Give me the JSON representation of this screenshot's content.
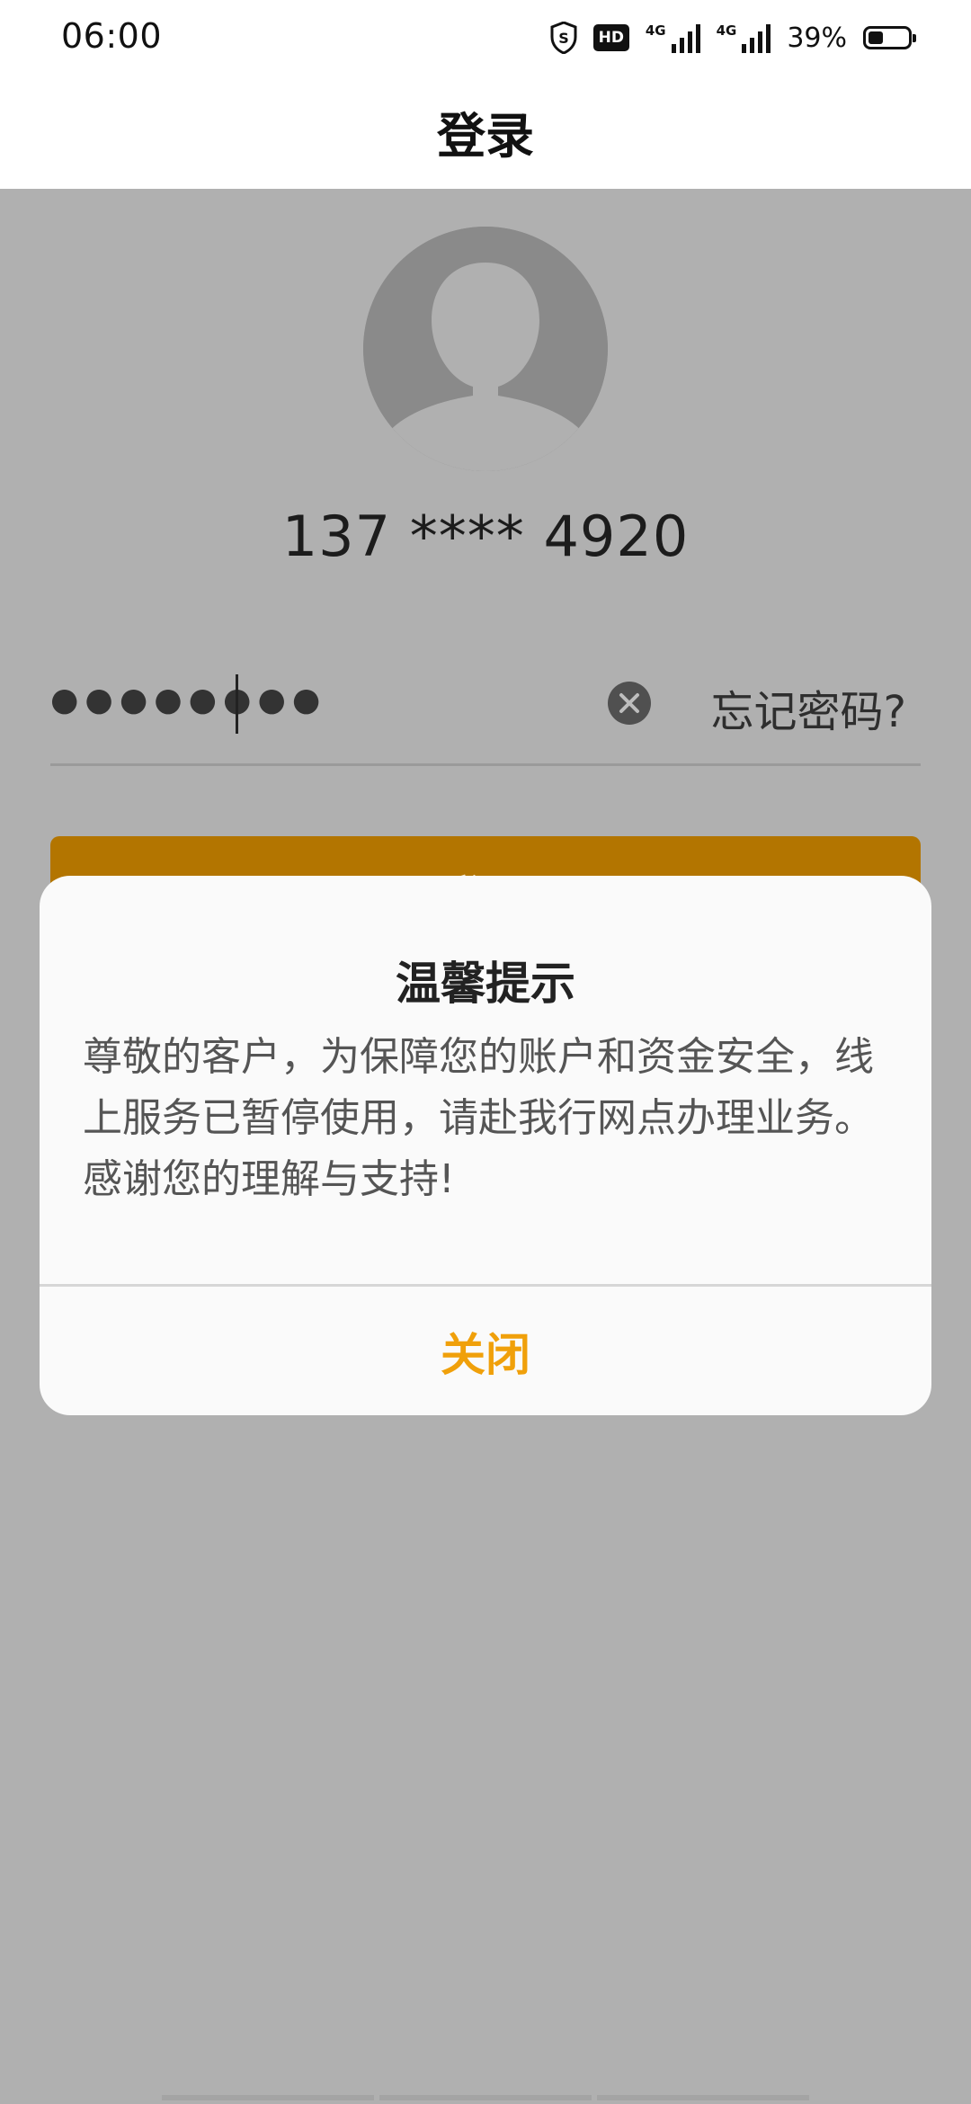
{
  "status_bar": {
    "time": "06:00",
    "hd_label": "HD",
    "signal1_label": "4G",
    "signal2_label": "4G",
    "battery_text": "39%",
    "battery_level": 0.39,
    "icons": [
      "shield-icon",
      "hd-icon",
      "signal-icon",
      "signal-icon",
      "battery-icon"
    ]
  },
  "header": {
    "title": "登录"
  },
  "account": {
    "phone": "137 **** 4920"
  },
  "password": {
    "masked_value": "●●●●●●●●",
    "forgot_label": "忘记密码?"
  },
  "login_button": {
    "label": "登录"
  },
  "dialog": {
    "title": "温馨提示",
    "message": "尊敬的客户，为保障您的账户和资金安全，线上服务已暂停使用，请赴我行网点办理业务。感谢您的理解与支持!",
    "close_label": "关闭"
  },
  "colors": {
    "overlay": "#b0b0b0",
    "button": "#b37500",
    "accent": "#f0a00a"
  }
}
